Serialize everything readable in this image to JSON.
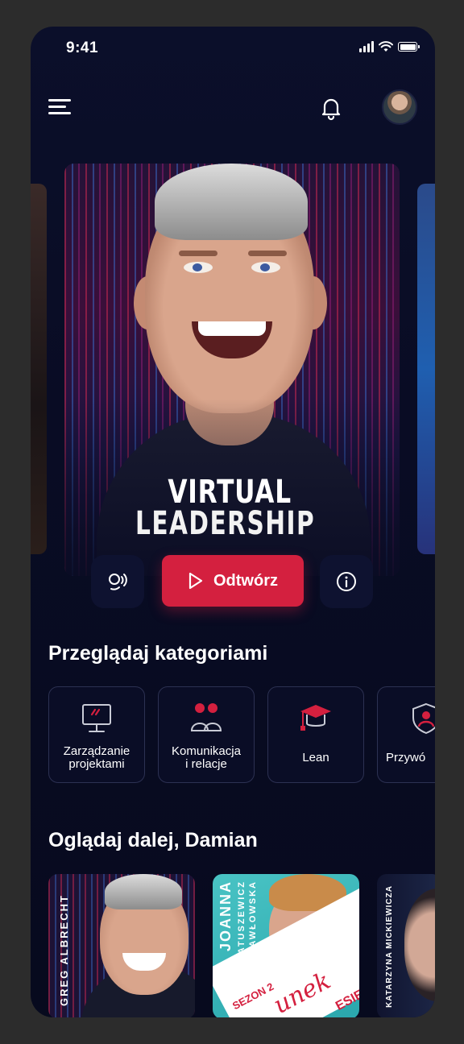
{
  "status_bar": {
    "time": "9:41"
  },
  "hero": {
    "title_line1": "VIRTUAL",
    "title_line2": "LEADERSHIP",
    "play_label": "Odtwórz"
  },
  "categories_section": {
    "title": "Przeglądaj kategoriami",
    "items": [
      {
        "label_line1": "Zarządzanie",
        "label_line2": "projektami",
        "icon": "monitor-icon"
      },
      {
        "label_line1": "Komunikacja",
        "label_line2": "i relacje",
        "icon": "people-chat-icon"
      },
      {
        "label_line1": "Lean",
        "label_line2": "",
        "icon": "graduation-cap-icon"
      },
      {
        "label_line1": "Przywó",
        "label_line2": "",
        "icon": "shield-person-icon"
      }
    ]
  },
  "continue_section": {
    "title": "Oglądaj dalej, Damian",
    "tiles": [
      {
        "name": "GREG ALBRECHT"
      },
      {
        "first_name": "JOANNA",
        "last_name": "MATUSZEWICZ",
        "last_name2": "-PAWŁOWSKA",
        "season": "SEZON 2",
        "script": "unek",
        "script2": "ESIE"
      },
      {
        "name": "KATARZYNA MICKIEWICZA"
      }
    ]
  },
  "colors": {
    "accent": "#d4203f",
    "background": "#090c24",
    "card_border": "#2c3152"
  }
}
